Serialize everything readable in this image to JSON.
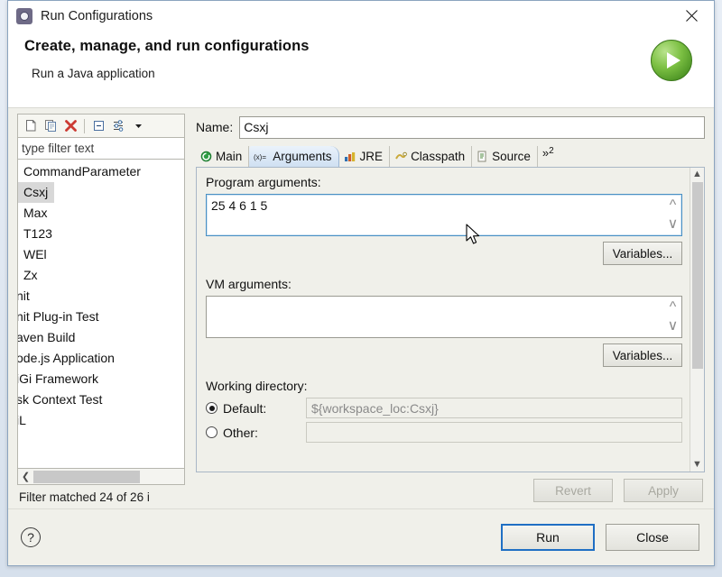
{
  "window": {
    "title": "Run Configurations",
    "icon": "run-configurations-icon",
    "close_icon": "close-icon"
  },
  "banner": {
    "title": "Create, manage, and run configurations",
    "subtitle": "Run a Java application",
    "badge_icon": "run-play-icon"
  },
  "left_panel": {
    "toolbar": [
      {
        "name": "new-configuration-icon",
        "tooltip": "New launch configuration"
      },
      {
        "name": "duplicate-configuration-icon",
        "tooltip": "Duplicate"
      },
      {
        "name": "delete-configuration-icon",
        "tooltip": "Delete"
      },
      {
        "name": "collapse-all-icon",
        "tooltip": "Collapse All"
      },
      {
        "name": "filter-icon",
        "tooltip": "Filter"
      },
      {
        "name": "chevron-down-icon",
        "tooltip": "Menu"
      }
    ],
    "filter": {
      "value": "type filter text",
      "placeholder": "type filter text"
    },
    "tree_items": [
      {
        "label": "CommandParameter",
        "selected": false,
        "clipped": false
      },
      {
        "label": "Csxj",
        "selected": true,
        "clipped": false
      },
      {
        "label": "Max",
        "selected": false,
        "clipped": false
      },
      {
        "label": "T123",
        "selected": false,
        "clipped": false
      },
      {
        "label": "WEl",
        "selected": false,
        "clipped": false
      },
      {
        "label": "Zx",
        "selected": false,
        "clipped": false
      },
      {
        "label": "nit",
        "selected": false,
        "clipped": true
      },
      {
        "label": "nit Plug-in Test",
        "selected": false,
        "clipped": true
      },
      {
        "label": "aven Build",
        "selected": false,
        "clipped": true
      },
      {
        "label": "ode.js Application",
        "selected": false,
        "clipped": true
      },
      {
        "label": "iGi Framework",
        "selected": false,
        "clipped": true
      },
      {
        "label": "sk Context Test",
        "selected": false,
        "clipped": true
      },
      {
        "label": "iL",
        "selected": false,
        "clipped": true
      }
    ],
    "hscroll": {
      "left_arrow": "chevron-left-icon"
    },
    "status": "Filter matched 24 of 26 i"
  },
  "config": {
    "name_label": "Name:",
    "name_value": "Csxj",
    "tabs": [
      {
        "label": "Main",
        "icon": "main-tab-icon",
        "active": false
      },
      {
        "label": "Arguments",
        "icon": "arguments-tab-icon",
        "active": true
      },
      {
        "label": "JRE",
        "icon": "jre-tab-icon",
        "active": false
      },
      {
        "label": "Classpath",
        "icon": "classpath-tab-icon",
        "active": false
      },
      {
        "label": "Source",
        "icon": "source-tab-icon",
        "active": false
      }
    ],
    "tab_overflow": {
      "symbol": "»",
      "count": "2"
    },
    "program_arguments": {
      "label": "Program arguments:",
      "value": "25 4 6 1 5",
      "variables_button": "Variables...",
      "focused": true
    },
    "vm_arguments": {
      "label": "VM arguments:",
      "value": "",
      "variables_button": "Variables..."
    },
    "working_directory": {
      "label": "Working directory:",
      "default_label": "Default:",
      "default_value": "${workspace_loc:Csxj}",
      "default_selected": true,
      "other_label": "Other:",
      "other_selected": false
    },
    "revert_button": "Revert",
    "apply_button": "Apply",
    "revert_enabled": false,
    "apply_enabled": false
  },
  "footer": {
    "help_icon": "help-icon",
    "help_glyph": "?",
    "run_button": "Run",
    "close_button": "Close"
  },
  "colors": {
    "accent_blue": "#1f6fc4",
    "run_green": "#7cc043",
    "delete_red": "#cc3b33",
    "selection_gray": "#d8d8d8"
  }
}
